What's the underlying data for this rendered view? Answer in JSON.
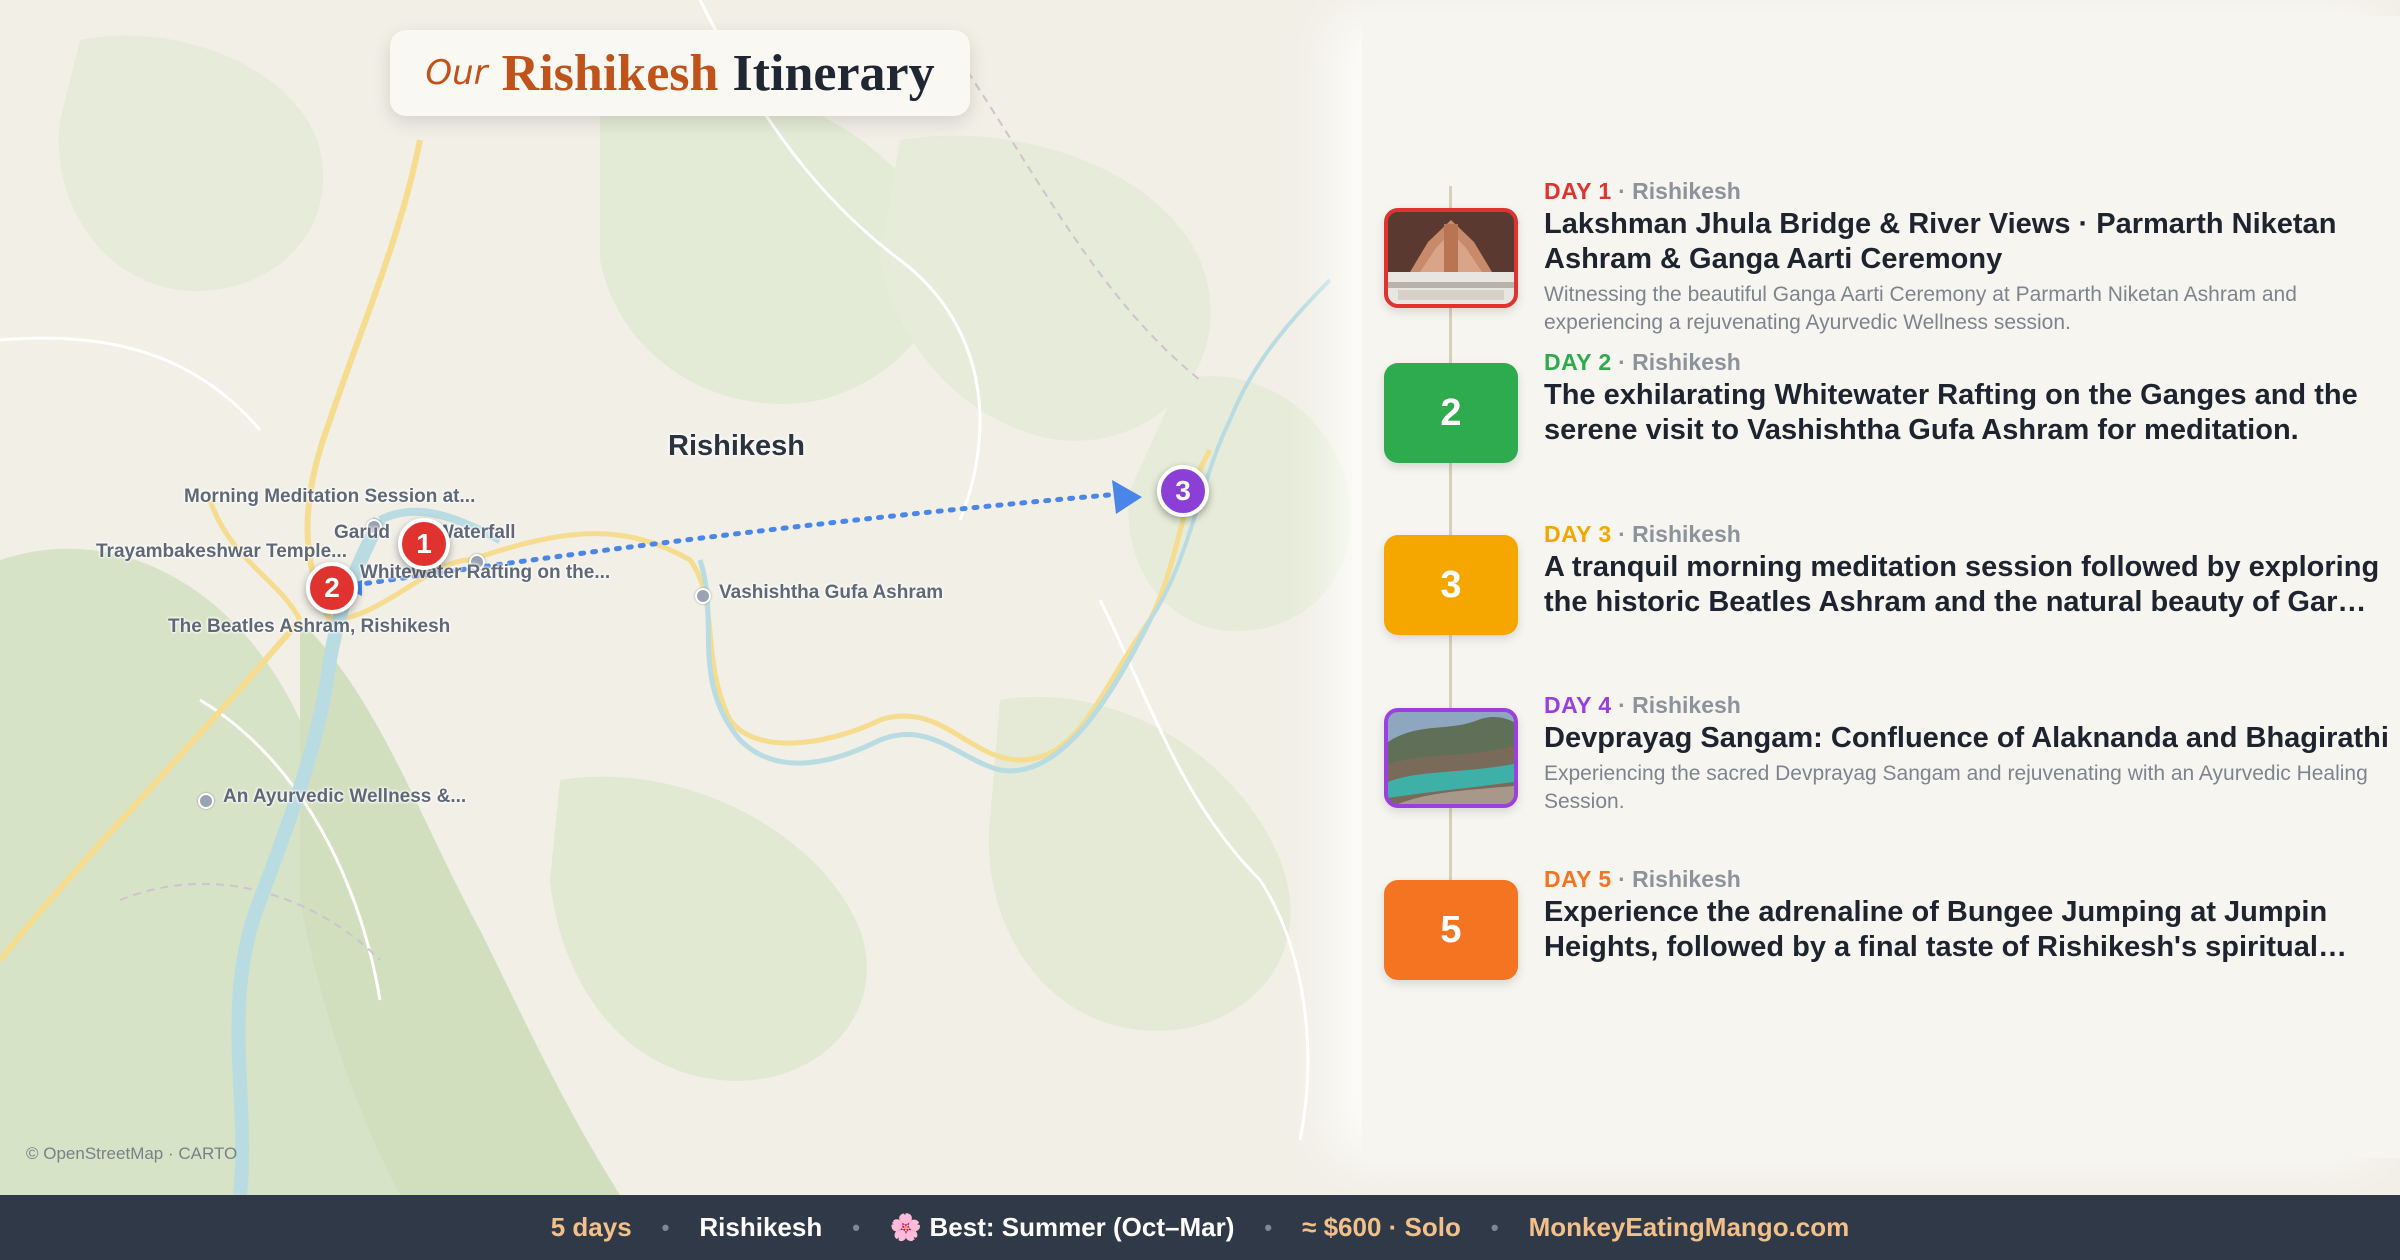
{
  "title": {
    "prefix": "Our",
    "place": "Rishikesh",
    "word": "Itinerary"
  },
  "map": {
    "city_label": "Rishikesh",
    "attribution": "© OpenStreetMap · CARTO",
    "places": [
      {
        "name": "Morning Meditation Session at..."
      },
      {
        "name": "Garud",
        "name_rest": "Waterfall"
      },
      {
        "name": "Trayambakeshwar Temple..."
      },
      {
        "name": "Whitewater Rafting on the..."
      },
      {
        "name": "The Beatles Ashram, Rishikesh"
      },
      {
        "name": "Vashishtha Gufa Ashram"
      },
      {
        "name": "An Ayurvedic Wellness &..."
      }
    ],
    "markers": [
      {
        "label": "1",
        "color": "#e0332f"
      },
      {
        "label": "2",
        "color": "#e0332f"
      },
      {
        "label": "3",
        "color": "#8b3fd6"
      }
    ],
    "route_color": "#4a86e8"
  },
  "days": [
    {
      "day_label": "DAY 1",
      "location": "Rishikesh",
      "color": "#e0332f",
      "title": "Lakshman Jhula Bridge & River Views · Parmarth Niketan Ashram & Ganga Aarti Ceremony",
      "description": "Witnessing the beautiful Ganga Aarti Ceremony at Parmarth Niketan Ashram and experiencing a rejuvenating Ayurvedic Wellness session.",
      "thumb": "temple-photo"
    },
    {
      "day_label": "DAY 2",
      "location": "Rishikesh",
      "color": "#2eaa4f",
      "badge": "2",
      "title": "The exhilarating Whitewater Rafting on the Ganges and the serene visit to Vashishtha Gufa Ashram for meditation.",
      "description": ""
    },
    {
      "day_label": "DAY 3",
      "location": "Rishikesh",
      "color": "#f5a700",
      "badge": "3",
      "title": "A tranquil morning meditation session followed by exploring the historic Beatles Ashram and the natural beauty of Gar…",
      "description": ""
    },
    {
      "day_label": "DAY 4",
      "location": "Rishikesh",
      "color": "#9b3fe0",
      "title": "Devprayag Sangam: Confluence of Alaknanda and Bhagirathi",
      "description": "Experiencing the sacred Devprayag Sangam and rejuvenating with an Ayurvedic Healing Session.",
      "thumb": "river-confluence-photo"
    },
    {
      "day_label": "DAY 5",
      "location": "Rishikesh",
      "color": "#f47422",
      "badge": "5",
      "title": "Experience the adrenaline of Bungee Jumping at Jumpin Heights, followed by a final taste of Rishikesh's spiritual…",
      "description": ""
    }
  ],
  "footer": {
    "duration": "5 days",
    "place": "Rishikesh",
    "season_icon": "🌸",
    "season": "Best: Summer (Oct–Mar)",
    "budget": "≈ $600 · Solo",
    "site": "MonkeyEatingMango.com",
    "separator": "•",
    "colors": {
      "duration": "#f3c08a",
      "place": "#ffffff",
      "season": "#ffffff",
      "budget": "#f3c08a",
      "site": "#f3c08a"
    }
  }
}
